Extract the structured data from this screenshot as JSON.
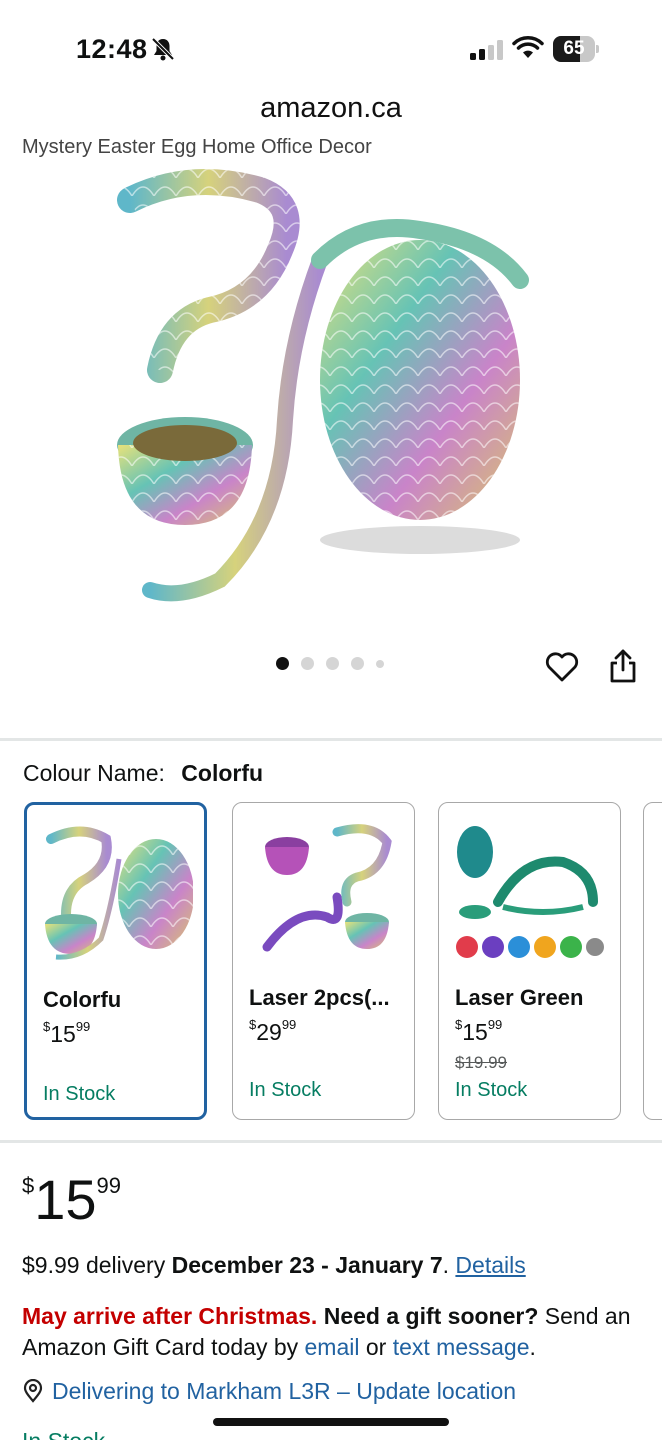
{
  "status": {
    "time": "12:48",
    "battery": "65",
    "battery_level": 0.65
  },
  "browser": {
    "url": "amazon.ca"
  },
  "product": {
    "title_fragment": "Mystery Easter Egg Home Office Decor"
  },
  "gallery": {
    "dot_count": 5,
    "active_index": 0
  },
  "colour": {
    "label": "Colour Name:",
    "value": "Colorfu",
    "options": [
      {
        "name": "Colorfu",
        "price_whole": "15",
        "price_cents": "99",
        "list_price": "",
        "stock": "In Stock",
        "selected": true
      },
      {
        "name": "Laser 2pcs(...",
        "price_whole": "29",
        "price_cents": "99",
        "list_price": "",
        "stock": "In Stock",
        "selected": false
      },
      {
        "name": "Laser Green",
        "price_whole": "15",
        "price_cents": "99",
        "list_price": "$19.99",
        "stock": "In Stock",
        "selected": false
      }
    ]
  },
  "price": {
    "currency": "$",
    "whole": "15",
    "cents": "99"
  },
  "delivery": {
    "prefix": "$9.99 delivery ",
    "dates": "December 23 - January 7",
    "suffix": ". ",
    "details_link": "Details"
  },
  "gift": {
    "warning": "May arrive after Christmas.",
    "question": "Need a gift sooner?",
    "text1": " Send an Amazon Gift Card today by ",
    "email_link": "email",
    "text2": " or ",
    "sms_link": "text message",
    "text3": "."
  },
  "location": {
    "text": "Delivering to Markham L3R – Update location"
  },
  "availability": {
    "text": "In Stock"
  },
  "colors": {
    "link": "#2162a1",
    "stock_green": "#067d62",
    "alert_red": "#c40000",
    "selected_border": "#2162a1"
  }
}
